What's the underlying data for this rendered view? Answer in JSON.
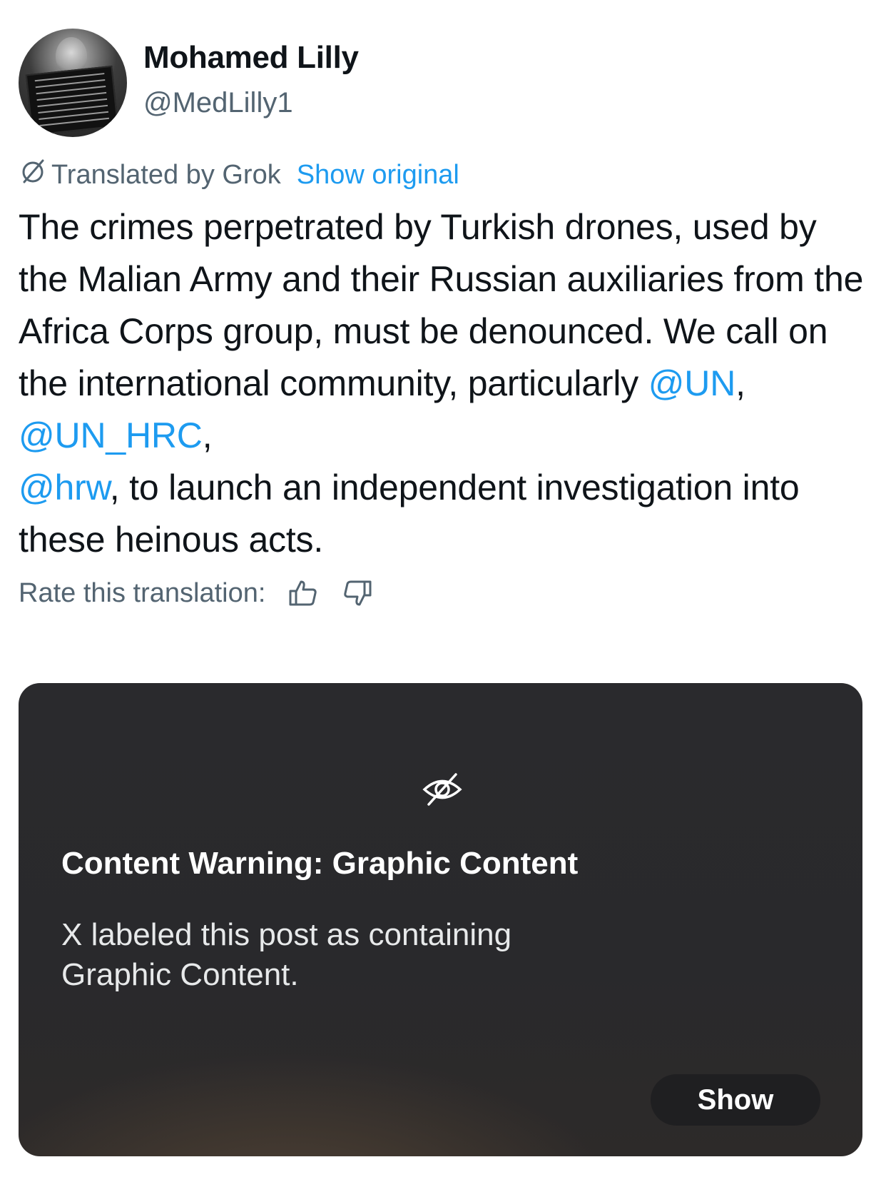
{
  "author": {
    "name": "Mohamed Lilly",
    "handle": "@MedLilly1",
    "avatar_icon": "profile-photo"
  },
  "translation": {
    "label": "Translated by Grok",
    "show_original": "Show original",
    "icon": "grok-icon"
  },
  "post": {
    "text_1": "The crimes perpetrated by Turkish drones, used by the Malian Army and their Russian auxiliaries from the Africa Corps group, must be denounced. We call on the international community, particularly ",
    "mention_1": "@UN",
    "sep_1": ", ",
    "mention_2": "@UN_HRC",
    "sep_2": ", ",
    "mention_3": "@hrw",
    "text_2": ", to launch an independent investigation into these heinous acts."
  },
  "rating": {
    "label": "Rate this translation:",
    "thumbs_up_icon": "thumbs-up-icon",
    "thumbs_down_icon": "thumbs-down-icon"
  },
  "content_warning": {
    "icon": "eye-slash-icon",
    "title": "Content Warning: Graphic Content",
    "body": "X labeled this post as containing Graphic Content.",
    "button": "Show"
  },
  "colors": {
    "link": "#1d9bf0",
    "secondary_text": "#536471",
    "primary_text": "#0f1419",
    "card_bg": "#2a2a2d"
  }
}
